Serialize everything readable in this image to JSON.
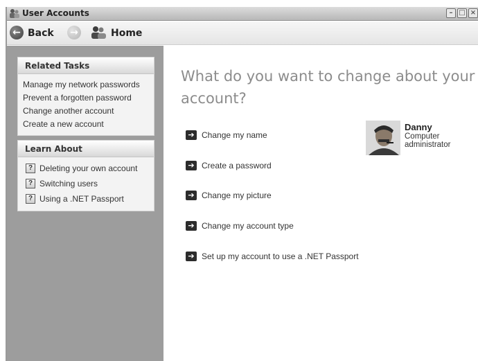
{
  "window": {
    "title": "User Accounts"
  },
  "titlebar_buttons": {
    "minimize": "–",
    "maximize": "□",
    "close": "×"
  },
  "toolbar": {
    "back_label": "Back",
    "home_label": "Home",
    "back_arrow": "←",
    "forward_arrow": "→"
  },
  "sidebar": {
    "related_tasks": {
      "title": "Related Tasks",
      "items": [
        "Manage my network passwords",
        "Prevent a forgotten password",
        "Change another account",
        "Create a new account"
      ]
    },
    "learn_about": {
      "title": "Learn About",
      "help_glyph": "?",
      "items": [
        "Deleting your own account",
        "Switching users",
        "Using a .NET Passport"
      ]
    }
  },
  "main": {
    "heading": "What do you want to change about your account?",
    "arrow_glyph": "➔",
    "actions": [
      "Change my name",
      "Create a password",
      "Change my picture",
      "Change my account type",
      "Set up my account to use a .NET Passport"
    ],
    "account": {
      "name": "Danny",
      "type": "Computer administrator"
    }
  },
  "icons": {
    "title": "user-accounts-icon",
    "back": "back-arrow-icon",
    "forward": "forward-arrow-icon",
    "home": "user-accounts-home-icon",
    "help": "help-icon",
    "action": "arrow-right-icon"
  }
}
